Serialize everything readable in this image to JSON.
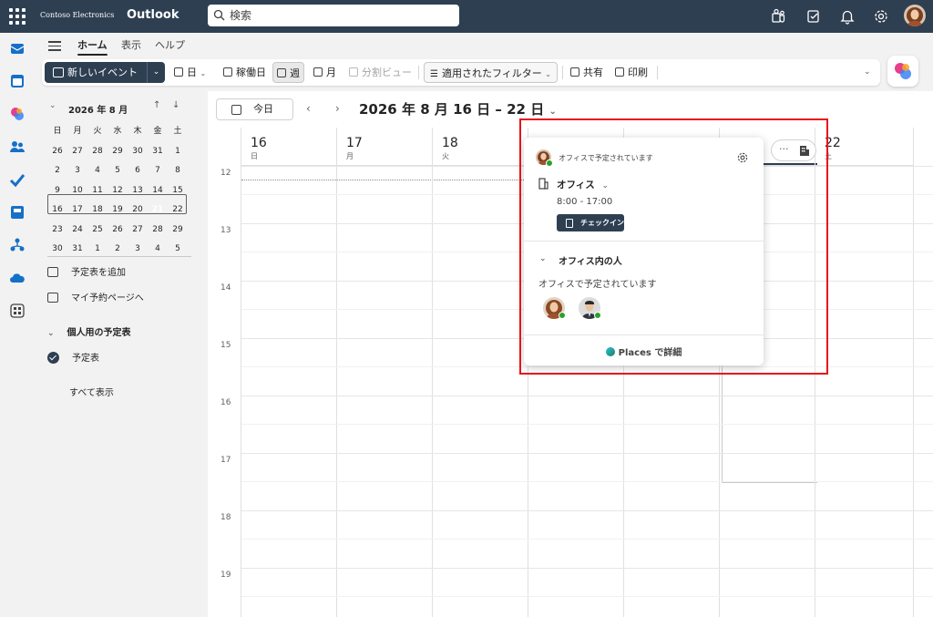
{
  "topbar": {
    "org": "Contoso Electronics",
    "app": "Outlook",
    "search_placeholder": "検索"
  },
  "ribbon_tabs": [
    "ホーム",
    "表示",
    "ヘルプ"
  ],
  "ribbon": {
    "new_event": "新しいイベント",
    "day": "日",
    "workweek": "稼働日",
    "week": "週",
    "month": "月",
    "split": "分割ビュー",
    "filter": "適用されたフィルター",
    "share": "共有",
    "print": "印刷"
  },
  "mini_calendar": {
    "title": "2026 年 8 月",
    "weekdays": [
      "日",
      "月",
      "火",
      "水",
      "木",
      "金",
      "土"
    ],
    "days": [
      "26",
      "27",
      "28",
      "29",
      "30",
      "31",
      "1",
      "2",
      "3",
      "4",
      "5",
      "6",
      "7",
      "8",
      "9",
      "10",
      "11",
      "12",
      "13",
      "14",
      "15",
      "16",
      "17",
      "18",
      "19",
      "20",
      "21",
      "22",
      "23",
      "24",
      "25",
      "26",
      "27",
      "28",
      "29",
      "30",
      "31",
      "1",
      "2",
      "3",
      "4",
      "5"
    ],
    "today": "21"
  },
  "left_pane": {
    "add_calendar": "予定表を追加",
    "booking_page": "マイ予約ページへ",
    "personal_header": "個人用の予定表",
    "calendar_item": "予定表",
    "show_all": "すべて表示"
  },
  "calendar": {
    "today_button": "今日",
    "range_title": "2026 年 8 月 16 日 – 22 日",
    "days": [
      {
        "num": "16",
        "wd": "日"
      },
      {
        "num": "17",
        "wd": "月"
      },
      {
        "num": "18",
        "wd": "火"
      },
      {
        "num": "",
        "wd": ""
      },
      {
        "num": "",
        "wd": ""
      },
      {
        "num": "",
        "wd": ""
      },
      {
        "num": "22",
        "wd": "土"
      }
    ],
    "hours": [
      "12",
      "13",
      "14",
      "15",
      "16",
      "17",
      "18",
      "19"
    ]
  },
  "popup": {
    "status": "オフィスで予定されています",
    "location": "オフィス",
    "hours": "8:00 - 17:00",
    "checkin": "チェックイン",
    "people_header": "オフィス内の人",
    "people_sched": "オフィスで予定されています",
    "places_link": "Places で詳細"
  },
  "overflow": "···",
  "colors": {
    "header": "#2e3f52",
    "accent": "#2e3f52",
    "highlight": "#e8131a",
    "presence": "#2aa12a"
  }
}
